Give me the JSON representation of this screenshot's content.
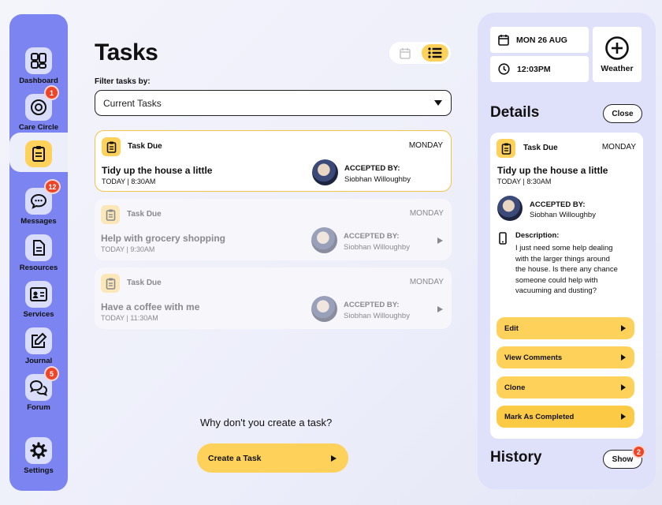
{
  "sidebar": {
    "items": [
      {
        "label": "Dashboard",
        "icon": "dashboard-icon"
      },
      {
        "label": "Care Circle",
        "icon": "care-circle-icon",
        "badge": "1"
      },
      {
        "label": "",
        "icon": "tasks-icon",
        "active": true
      },
      {
        "label": "Messages",
        "icon": "messages-icon",
        "badge": "12"
      },
      {
        "label": "Resources",
        "icon": "resources-icon"
      },
      {
        "label": "Services",
        "icon": "services-icon"
      },
      {
        "label": "Journal",
        "icon": "journal-icon"
      },
      {
        "label": "Forum",
        "icon": "forum-icon",
        "badge": "5"
      },
      {
        "label": "Settings",
        "icon": "settings-icon"
      }
    ]
  },
  "main": {
    "title": "Tasks",
    "filter_label": "Filter tasks by:",
    "filter_value": "Current Tasks",
    "tasks": [
      {
        "due_label": "Task Due",
        "day": "MONDAY",
        "title": "Tidy up the house a little",
        "time": "TODAY | 8:30AM",
        "accepted_label": "ACCEPTED BY:",
        "accepted_name": "Siobhan Willoughby"
      },
      {
        "due_label": "Task Due",
        "day": "MONDAY",
        "title": "Help with grocery shopping",
        "time": "TODAY | 9:30AM",
        "accepted_label": "ACCEPTED BY:",
        "accepted_name": "Siobhan Willoughby"
      },
      {
        "due_label": "Task Due",
        "day": "MONDAY",
        "title": "Have a coffee with me",
        "time": "TODAY | 11:30AM",
        "accepted_label": "ACCEPTED BY:",
        "accepted_name": "Siobhan Willoughby"
      }
    ],
    "cta_text": "Why don't you create a task?",
    "create_button": "Create a Task"
  },
  "panel": {
    "date": "MON 26 AUG",
    "time": "12:03PM",
    "weather_label": "Weather",
    "details_title": "Details",
    "close_label": "Close",
    "detail": {
      "due_label": "Task Due",
      "day": "MONDAY",
      "title": "Tidy up the house a little",
      "time": "TODAY | 8:30AM",
      "accepted_label": "ACCEPTED BY:",
      "accepted_name": "Siobhan Willoughby",
      "description_label": "Description:",
      "description": "I just need some help dealing with the larger things around the house. Is there any chance someone could help with vacuuming and dusting?"
    },
    "actions": [
      "Edit",
      "View Comments",
      "Clone",
      "Mark As Completed"
    ],
    "history_title": "History",
    "show_label": "Show",
    "show_badge": "2"
  },
  "colors": {
    "sidebar": "#7b84f0",
    "accent": "#fdd15a",
    "badge": "#f04428",
    "panel": "#dfe1fb"
  }
}
